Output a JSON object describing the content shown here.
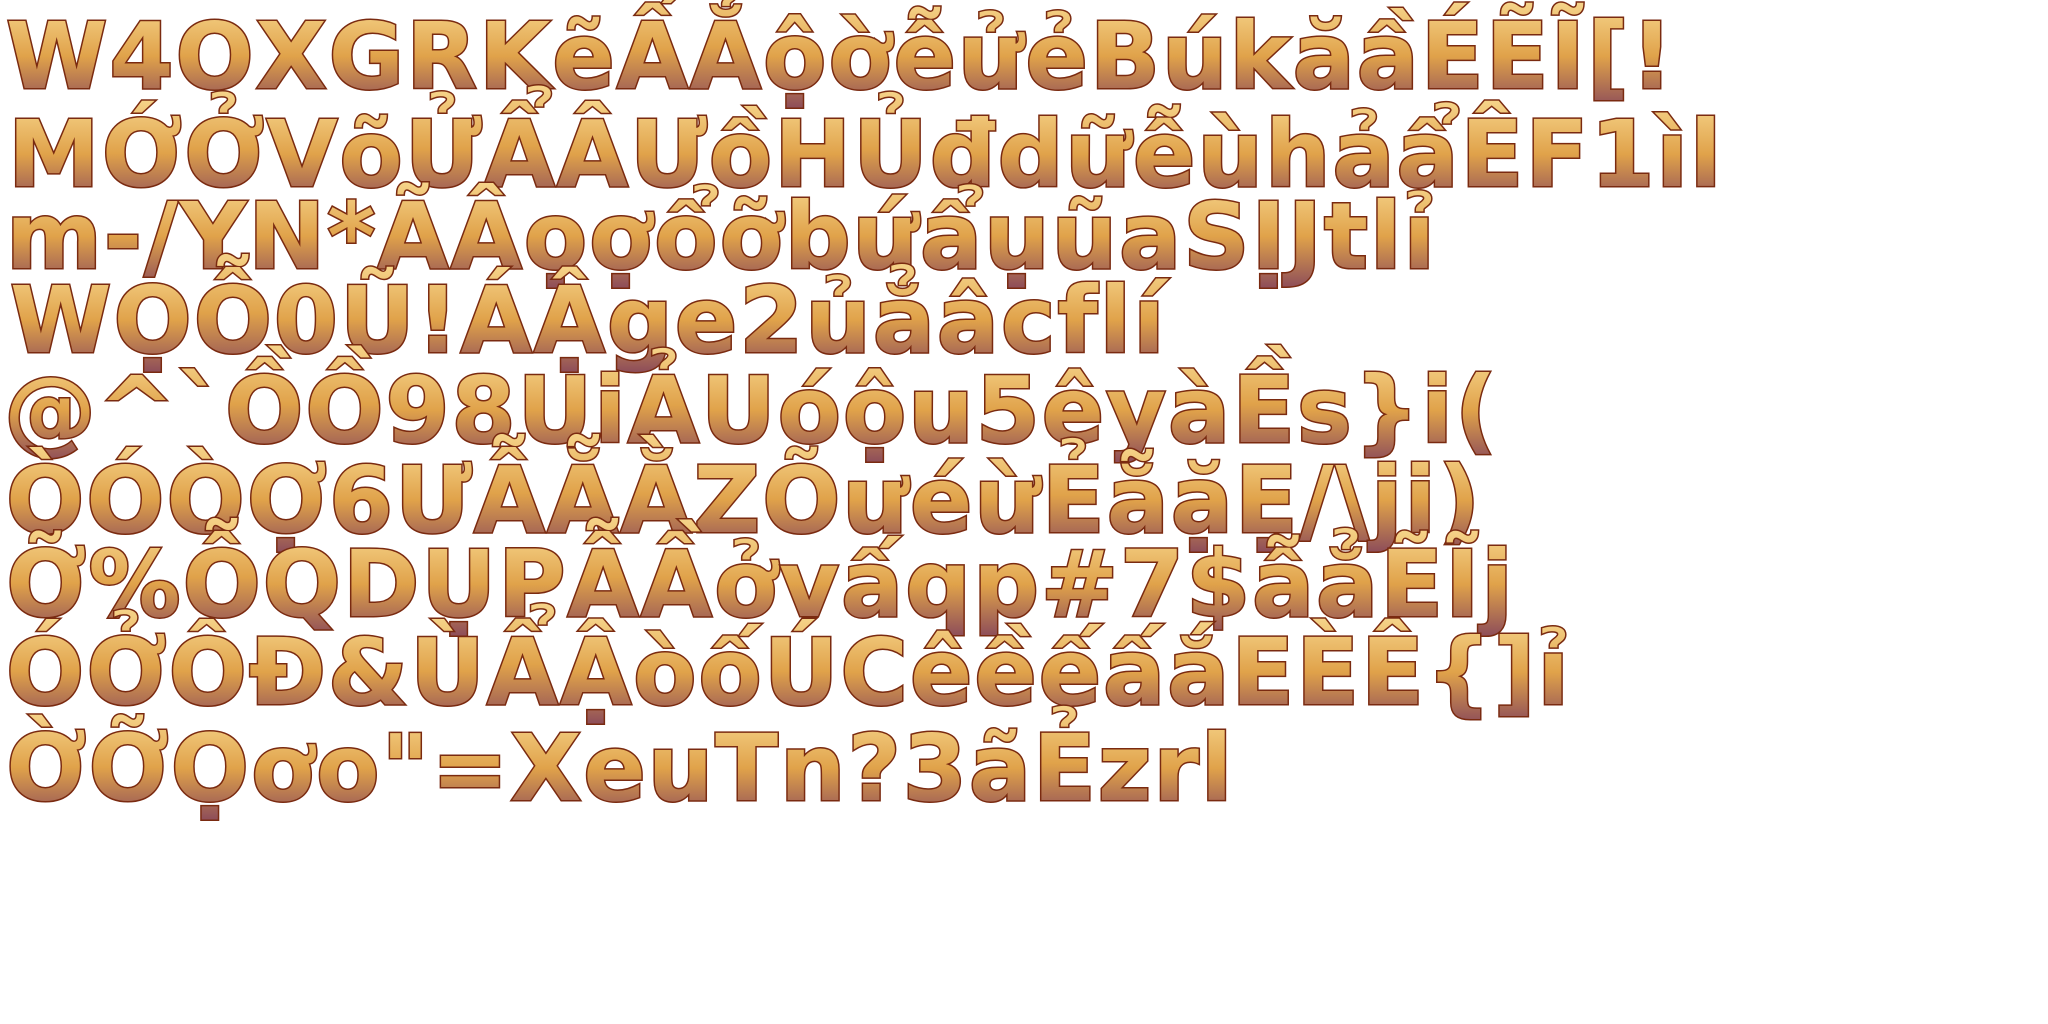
{
  "sheet": {
    "background": "#ffffff",
    "gradient_top": "#f6d48a",
    "gradient_mid": "#e0a24a",
    "gradient_bottom": "#8a4a5a",
    "outline": "#7a2a10"
  },
  "rows": [
    [
      "W",
      "4",
      "O",
      "X",
      "G",
      "R",
      "K",
      "ẽ",
      "Ấ",
      "Ẳ",
      "ộ",
      "ờ",
      "ễ",
      "ử",
      "ẻ",
      "B",
      "ú",
      "k",
      "ă",
      "ầ",
      "É",
      "Ẽ",
      "Ĩ",
      "[",
      "!"
    ],
    [
      "M",
      "Ớ",
      "Ở",
      "V",
      "õ",
      "Ử",
      "Ẩ",
      "Â",
      "Ư",
      "ồ",
      "H",
      "Ủ",
      "đ",
      "d",
      "ữ",
      "ễ",
      "ù",
      "h",
      "ả",
      "ẩ",
      "Ê",
      "F",
      "1",
      "ì",
      "l"
    ],
    [
      "m",
      "-",
      "/",
      "Y",
      "N",
      "*",
      "Ã",
      "Â",
      "ọ",
      "ợ",
      "ổ",
      "ỡ",
      "b",
      "ứ",
      "ẩ",
      "ụ",
      "ũ",
      "a",
      "S",
      "Ị",
      "J",
      "t",
      "l",
      "ỉ"
    ],
    [
      "W",
      "Ọ",
      "Ỗ",
      "0",
      "Ũ",
      "!",
      "Á",
      "Ậ",
      "g",
      "e",
      "2",
      "ủ",
      "ẳ",
      "â",
      "c",
      "f",
      "l",
      "í"
    ],
    [
      "@",
      "^",
      "`",
      "Ồ",
      "Ồ",
      "9",
      "8",
      "U",
      "i",
      "Ả",
      "U",
      "ó",
      "ộ",
      "u",
      "5",
      "ê",
      "y",
      "à",
      "Ề",
      "s",
      "}",
      "i",
      "("
    ],
    [
      "Ò",
      "Ó",
      "Ò",
      "Ợ",
      "6",
      "Ư",
      "Ẫ",
      "Ẵ",
      "Ằ",
      "Z",
      "Õ",
      "ư",
      "é",
      "ừ",
      "Ẻ",
      "ẵ",
      "ặ",
      "Ẹ",
      "/",
      "\\",
      "j",
      "i",
      ")"
    ],
    [
      "Ỡ",
      "%",
      "Ỗ",
      "Q",
      "D",
      "Ụ",
      "P",
      "Ẫ",
      "Ầ",
      "ở",
      "v",
      "ấ",
      "q",
      "p",
      "#",
      "7",
      "$",
      "ẫ",
      "ẳ",
      "Ẽ",
      "Ĩ",
      "j"
    ],
    [
      "Ó",
      "Ở",
      "Ô",
      "Đ",
      "&",
      "Ù",
      "Ẩ",
      "Ậ",
      "ò",
      "ố",
      "Ú",
      "C",
      "ê",
      "ề",
      "ế",
      "ấ",
      "ắ",
      "E",
      "È",
      "Ê",
      "{",
      "]",
      "ỉ"
    ],
    [
      "Ờ",
      "Ỡ",
      "Ọ",
      "ơ",
      "o",
      "\"",
      "=",
      "X",
      "e",
      "u",
      "T",
      "n",
      "?",
      "3",
      "ã",
      "Ẻ",
      "z",
      "r",
      "l"
    ]
  ]
}
